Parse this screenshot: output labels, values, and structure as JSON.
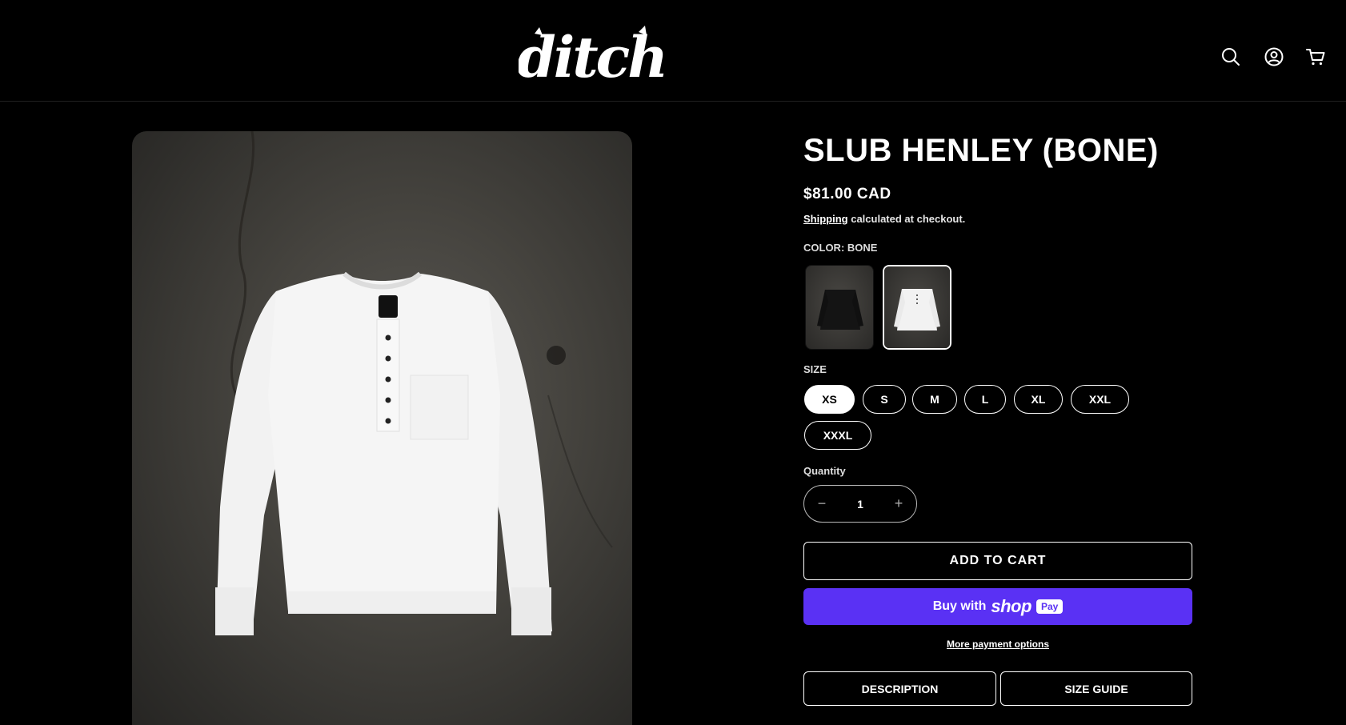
{
  "header": {
    "logo_text": "ditch",
    "icons": [
      "search-icon",
      "account-icon",
      "cart-icon"
    ]
  },
  "product": {
    "title": "SLUB HENLEY (BONE)",
    "price": "$81.00 CAD",
    "shipping_link": "Shipping",
    "shipping_text": " calculated at checkout.",
    "color_label": "COLOR: BONE",
    "colors": [
      {
        "name": "Black",
        "selected": false
      },
      {
        "name": "Bone",
        "selected": true
      }
    ],
    "size_label": "SIZE",
    "sizes": [
      {
        "label": "XS",
        "selected": true
      },
      {
        "label": "S",
        "selected": false
      },
      {
        "label": "M",
        "selected": false
      },
      {
        "label": "L",
        "selected": false
      },
      {
        "label": "XL",
        "selected": false
      },
      {
        "label": "XXL",
        "selected": false
      },
      {
        "label": "XXXL",
        "selected": false
      }
    ],
    "quantity_label": "Quantity",
    "quantity_value": "1",
    "qty_minus": "−",
    "qty_plus": "+",
    "add_to_cart": "ADD TO CART",
    "buy_with": "Buy with",
    "shop_word": "shop",
    "pay_badge": "Pay",
    "more_payment": "More payment options",
    "tabs": [
      "DESCRIPTION",
      "SIZE GUIDE"
    ]
  },
  "colors": {
    "background": "#000000",
    "shop_pay": "#5a31f4",
    "text": "#ffffff"
  }
}
